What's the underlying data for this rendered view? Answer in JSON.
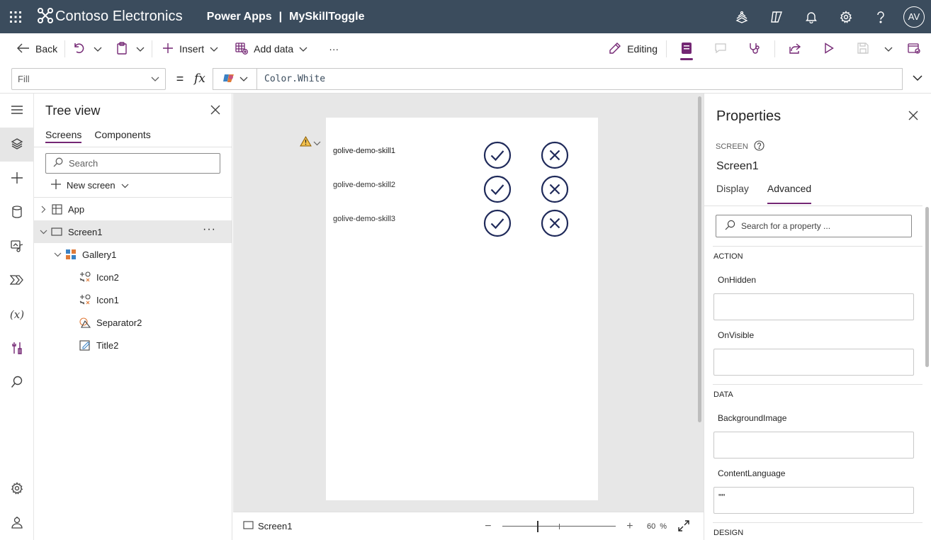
{
  "header": {
    "org_name": "Contoso Electronics",
    "product": "Power Apps",
    "separator": "|",
    "app_name": "MySkillToggle",
    "avatar_initials": "AV",
    "bg_color": "#3b4c5d"
  },
  "commandbar": {
    "back_label": "Back",
    "insert_label": "Insert",
    "add_data_label": "Add data",
    "more_label": "···",
    "editing_label": "Editing"
  },
  "formulabar": {
    "property": "Fill",
    "equals": "=",
    "fx": "fx",
    "formula": "Color.White"
  },
  "tree": {
    "title": "Tree view",
    "tabs": [
      "Screens",
      "Components"
    ],
    "search_placeholder": "Search",
    "new_screen_label": "New screen",
    "items": [
      {
        "label": "App"
      },
      {
        "label": "Screen1"
      },
      {
        "label": "Gallery1"
      },
      {
        "label": "Icon2"
      },
      {
        "label": "Icon1"
      },
      {
        "label": "Separator2"
      },
      {
        "label": "Title2"
      }
    ],
    "more_label": "···"
  },
  "canvas": {
    "gallery_rows": [
      {
        "label": "golive-demo-skill1"
      },
      {
        "label": "golive-demo-skill2"
      },
      {
        "label": "golive-demo-skill3"
      }
    ],
    "footer_screen": "Screen1",
    "zoom_value": "60",
    "zoom_unit": "%",
    "zoom_minus": "−",
    "zoom_plus": "+"
  },
  "properties": {
    "title": "Properties",
    "type_label": "SCREEN",
    "screen_name": "Screen1",
    "tabs": [
      "Display",
      "Advanced"
    ],
    "search_placeholder": "Search for a property ...",
    "sections": [
      {
        "title": "ACTION"
      },
      {
        "title": "DATA"
      },
      {
        "title": "DESIGN"
      }
    ],
    "fields": [
      {
        "label": "OnHidden",
        "value": ""
      },
      {
        "label": "OnVisible",
        "value": ""
      },
      {
        "label": "BackgroundImage",
        "value": ""
      },
      {
        "label": "ContentLanguage",
        "value": "\"\""
      }
    ]
  },
  "colors": {
    "accent": "#742774",
    "icon_navy": "#1f2a5a"
  }
}
